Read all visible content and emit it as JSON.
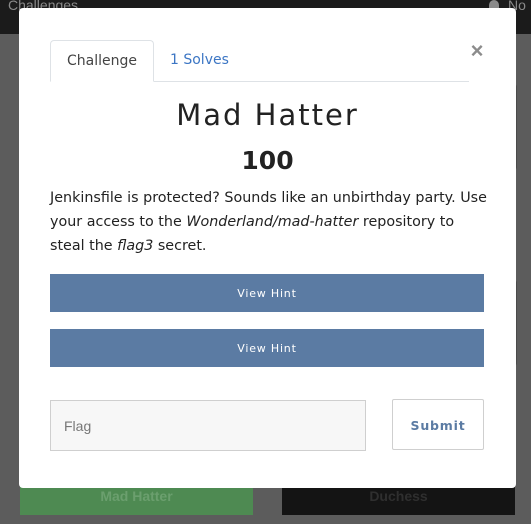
{
  "background": {
    "nav_left": "Challenges",
    "nav_right": "No",
    "card_left_label": "Mad Hatter",
    "card_right_label": "Duchess"
  },
  "modal": {
    "tabs": [
      {
        "label": "Challenge",
        "active": true
      },
      {
        "label": "1 Solves",
        "active": false
      }
    ],
    "close_label": "×",
    "title": "Mad Hatter",
    "points": "100",
    "description": {
      "p1": "Jenkinsfile is protected? Sounds like an unbirthday party. Use your access to the ",
      "repo": "Wonderland/mad-hatter",
      "p2": " repository to steal the ",
      "secret": "flag3",
      "p3": " secret."
    },
    "hints": [
      {
        "label": "View Hint"
      },
      {
        "label": "View Hint"
      }
    ],
    "flag_input": {
      "placeholder": "Flag",
      "value": ""
    },
    "submit_label": "Submit"
  },
  "colors": {
    "hint_button": "#5b7ba3",
    "tab_link": "#3c76c4",
    "overlay": "#5c5c5c"
  }
}
